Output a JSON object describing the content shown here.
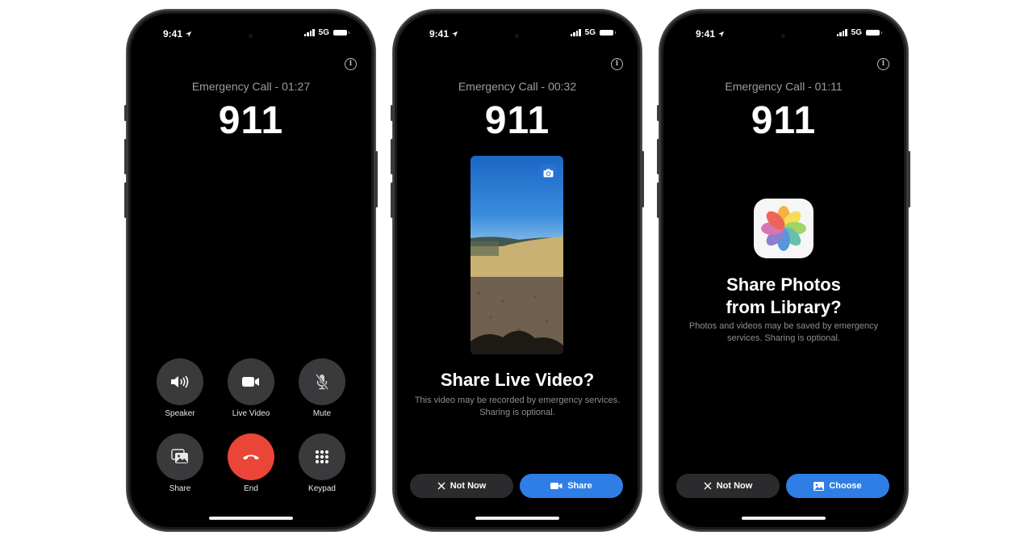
{
  "colors": {
    "end_red": "#eb4537",
    "primary_blue": "#2f7ee6",
    "control_gray": "#3a3a3c"
  },
  "phones": [
    {
      "status": {
        "time": "9:41",
        "network": "5G"
      },
      "call_title": "Emergency Call - 01:27",
      "number": "911",
      "controls": [
        {
          "label": "Speaker",
          "icon": "speaker-icon"
        },
        {
          "label": "Live Video",
          "icon": "video-camera-icon"
        },
        {
          "label": "Mute",
          "icon": "mic-muted-icon"
        },
        {
          "label": "Share",
          "icon": "photos-stack-icon"
        },
        {
          "label": "End",
          "icon": "end-call-icon"
        },
        {
          "label": "Keypad",
          "icon": "keypad-icon"
        }
      ]
    },
    {
      "status": {
        "time": "9:41",
        "network": "5G"
      },
      "call_title": "Emergency Call - 00:32",
      "number": "911",
      "prompt_title": "Share Live Video?",
      "prompt_sub": "This video may be recorded by emergency services. Sharing is optional.",
      "secondary_label": "Not Now",
      "primary_label": "Share"
    },
    {
      "status": {
        "time": "9:41",
        "network": "5G"
      },
      "call_title": "Emergency Call - 01:11",
      "number": "911",
      "prompt_title_line1": "Share Photos",
      "prompt_title_line2": "from Library?",
      "prompt_sub": "Photos and videos may be saved by emergency services. Sharing is optional.",
      "secondary_label": "Not Now",
      "primary_label": "Choose"
    }
  ]
}
